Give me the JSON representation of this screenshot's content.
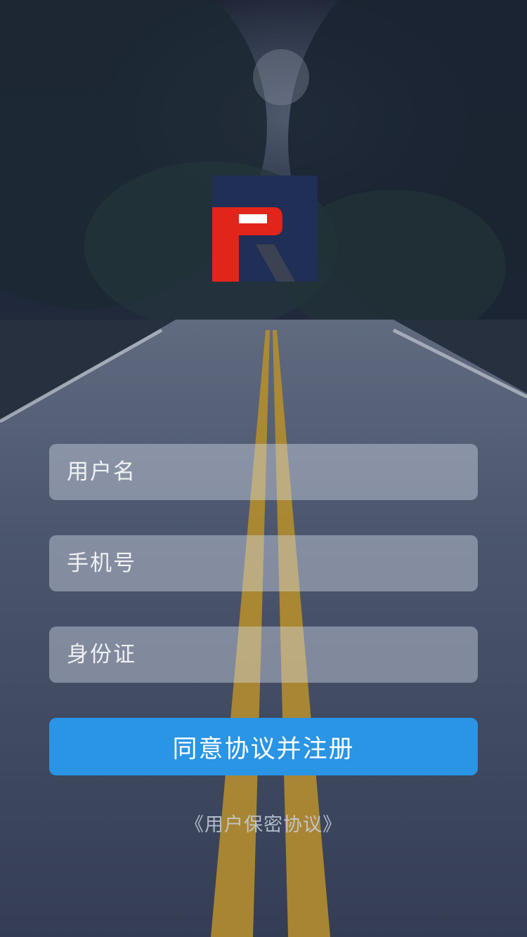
{
  "form": {
    "username_placeholder": "用户名",
    "phone_placeholder": "手机号",
    "id_card_placeholder": "身份证",
    "submit_label": "同意协议并注册"
  },
  "footer": {
    "agreement_link": "《用户保密协议》"
  },
  "colors": {
    "primary_button": "#2a94e5",
    "logo_red": "#e1251b",
    "logo_navy": "#1f2f55"
  },
  "icons": {
    "logo": "brand-logo-r"
  }
}
